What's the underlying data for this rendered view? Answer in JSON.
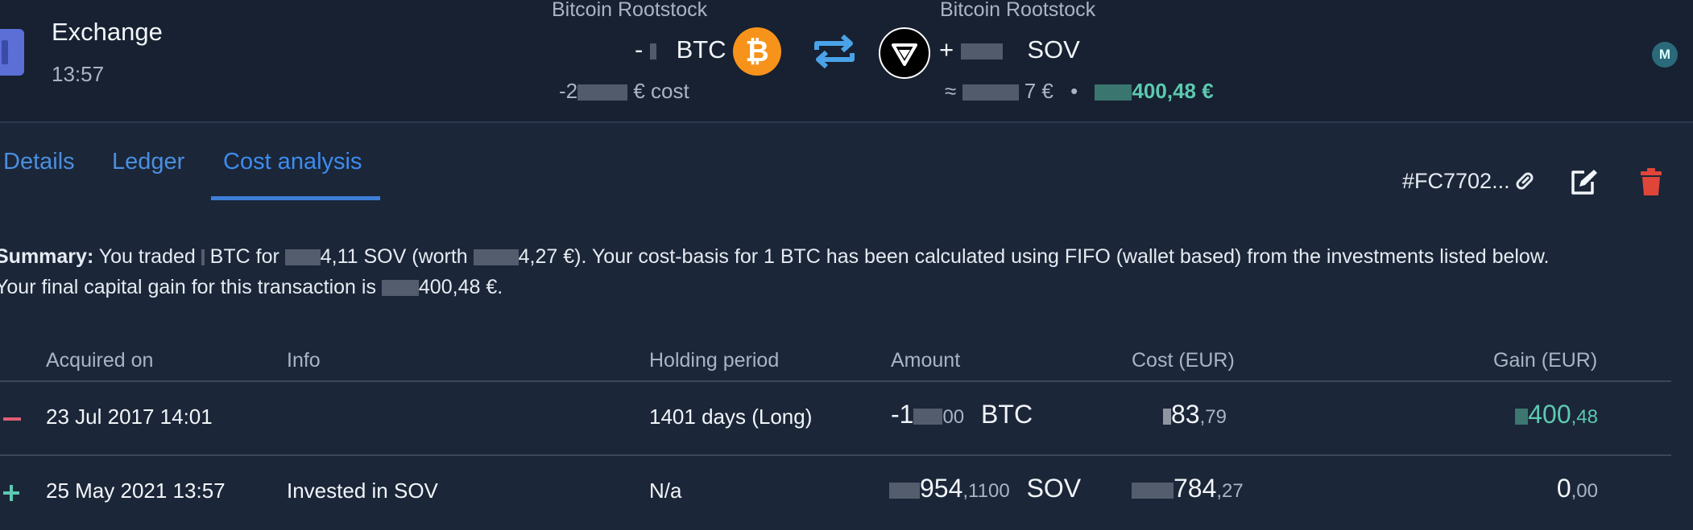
{
  "header": {
    "title": "Exchange",
    "time": "13:57",
    "sent": {
      "network": "Bitcoin Rootstock",
      "amount_prefix": "- ",
      "currency": "BTC",
      "cost_prefix": "-2",
      "cost_suffix": "€ cost"
    },
    "received": {
      "network": "Bitcoin Rootstock",
      "amount_prefix": "+ ",
      "currency": "SOV",
      "value_prefix": "≈ ",
      "value_suffix": "7 €",
      "separator": "•",
      "gain": "400,48 €"
    },
    "avatar_initial": "M"
  },
  "tabs": [
    {
      "label": "Details",
      "active": false
    },
    {
      "label": "Ledger",
      "active": false
    },
    {
      "label": "Cost analysis",
      "active": true
    }
  ],
  "actions": {
    "tx_id": "#FC7702..."
  },
  "summary": {
    "label": "Summary:",
    "part1": " You traded ",
    "part2": " BTC for ",
    "part3": "4,11 SOV (worth ",
    "part4": "4,27 €). Your cost-basis for 1 BTC has been calculated using FIFO (wallet based) from the investments listed below.",
    "part5": "Your final capital gain for this transaction is ",
    "part6": "400,48 €."
  },
  "table": {
    "headers": {
      "acquired": "Acquired on",
      "info": "Info",
      "holding": "Holding period",
      "amount": "Amount",
      "cost": "Cost (EUR)",
      "gain": "Gain (EUR)"
    },
    "rows": [
      {
        "sign": "minus",
        "acquired": "23 Jul 2017 14:01",
        "info": "",
        "holding": "1401 days (Long)",
        "amount_int": "-1",
        "amount_dec": "00",
        "amount_currency": "BTC",
        "cost_int": "83",
        "cost_dec": ",79",
        "gain_int": "400",
        "gain_dec": ",48"
      },
      {
        "sign": "plus",
        "acquired": "25 May 2021 13:57",
        "info": "Invested in SOV",
        "holding": "N/a",
        "amount_int": "954",
        "amount_dec": ",1100",
        "amount_currency": "SOV",
        "cost_int": "784",
        "cost_dec": ",27",
        "gain_int": "0",
        "gain_dec": ",00"
      }
    ]
  },
  "colors": {
    "background": "#1b2638",
    "accent_blue": "#3d8cf0",
    "gain_teal": "#5cc9b0",
    "loss_red": "#e05d74",
    "trash_red": "#e0453a",
    "btc_orange": "#f7931a"
  },
  "icons": {
    "type": "exchange-type-icon",
    "btc": "bitcoin-icon",
    "sov": "sovryn-icon",
    "swap": "swap-arrows-icon",
    "link": "link-icon",
    "edit": "edit-icon",
    "trash": "trash-icon"
  }
}
